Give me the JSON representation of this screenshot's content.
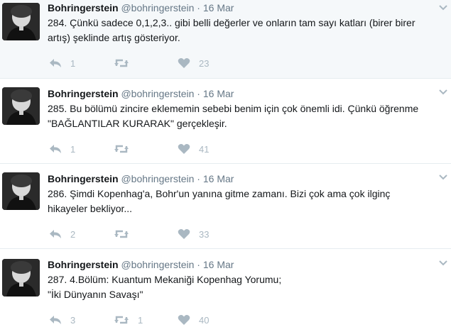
{
  "tweets": [
    {
      "name": "Bohringerstein",
      "handle": "@bohringerstein",
      "sep": "·",
      "date": "16 Mar",
      "text": "284. Çünkü sadece 0,1,2,3.. gibi belli değerler ve onların tam sayı katları (birer birer artış) şeklinde artış gösteriyor.",
      "replies": "1",
      "retweets": "",
      "likes": "23"
    },
    {
      "name": "Bohringerstein",
      "handle": "@bohringerstein",
      "sep": "·",
      "date": "16 Mar",
      "text": "285. Bu bölümü zincire eklememin sebebi benim için çok önemli idi. Çünkü öğrenme \"BAĞLANTILAR KURARAK\" gerçekleşir.",
      "replies": "1",
      "retweets": "",
      "likes": "41"
    },
    {
      "name": "Bohringerstein",
      "handle": "@bohringerstein",
      "sep": "·",
      "date": "16 Mar",
      "text": "286. Şimdi Kopenhag'a, Bohr'un yanına gitme zamanı. Bizi çok ama çok ilginç hikayeler bekliyor...",
      "replies": "2",
      "retweets": "",
      "likes": "33"
    },
    {
      "name": "Bohringerstein",
      "handle": "@bohringerstein",
      "sep": "·",
      "date": "16 Mar",
      "text_line1": "287. 4.Bölüm: Kuantum Mekaniği Kopenhag Yorumu;",
      "text_line2": "\"İki Dünyanın Savaşı\"",
      "replies": "3",
      "retweets": "1",
      "likes": "40"
    }
  ],
  "icons": {
    "reply": "reply-icon",
    "retweet": "retweet-icon",
    "like": "heart-icon",
    "more": "chevron-down-icon",
    "avatar": "avatar"
  },
  "colors": {
    "thread_line": "#a9d6ea",
    "icon_gray": "#aab8c2",
    "highlight_bg": "#f5f8fa"
  }
}
